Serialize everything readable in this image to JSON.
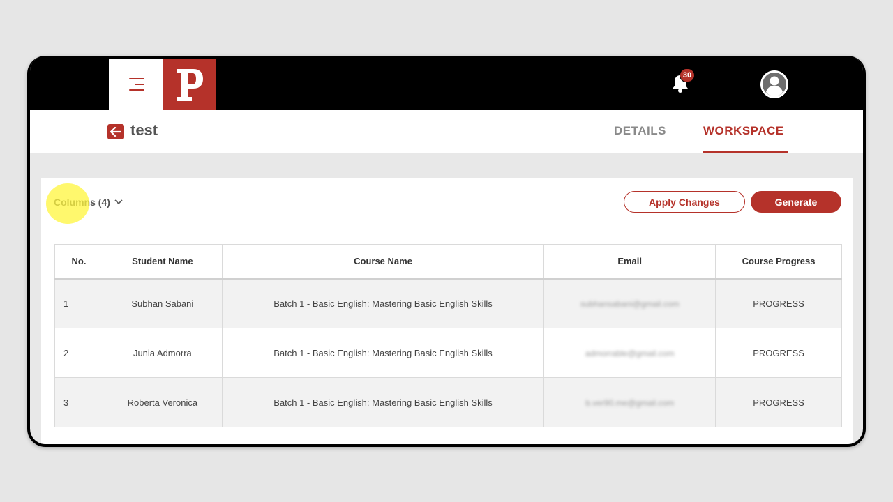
{
  "topbar": {
    "logo_letter": "P",
    "notification_count": "30",
    "brand_color": "#b5322a"
  },
  "subheader": {
    "title": "test",
    "tabs": [
      {
        "label": "DETAILS",
        "active": false
      },
      {
        "label": "WORKSPACE",
        "active": true
      }
    ]
  },
  "toolbar": {
    "columns_label": "Columns (4)",
    "apply_label": "Apply Changes",
    "generate_label": "Generate"
  },
  "table": {
    "headers": [
      "No.",
      "Student Name",
      "Course Name",
      "Email",
      "Course Progress"
    ],
    "rows": [
      {
        "no": "1",
        "student": "Subhan Sabani",
        "course": "Batch 1 - Basic English: Mastering Basic English Skills",
        "email": "subhansabani@gmail.com",
        "progress": "PROGRESS"
      },
      {
        "no": "2",
        "student": "Junia Admorra",
        "course": "Batch 1 - Basic English: Mastering Basic English Skills",
        "email": "admorrable@gmail.com",
        "progress": "PROGRESS"
      },
      {
        "no": "3",
        "student": "Roberta Veronica",
        "course": "Batch 1 - Basic English: Mastering Basic English Skills",
        "email": "b.ver90.me@gmail.com",
        "progress": "PROGRESS"
      }
    ]
  },
  "icons": {
    "menu": "hamburger-icon",
    "back": "arrow-left-icon",
    "bell": "bell-icon",
    "avatar": "user-avatar-icon",
    "chevron": "chevron-down-icon"
  }
}
